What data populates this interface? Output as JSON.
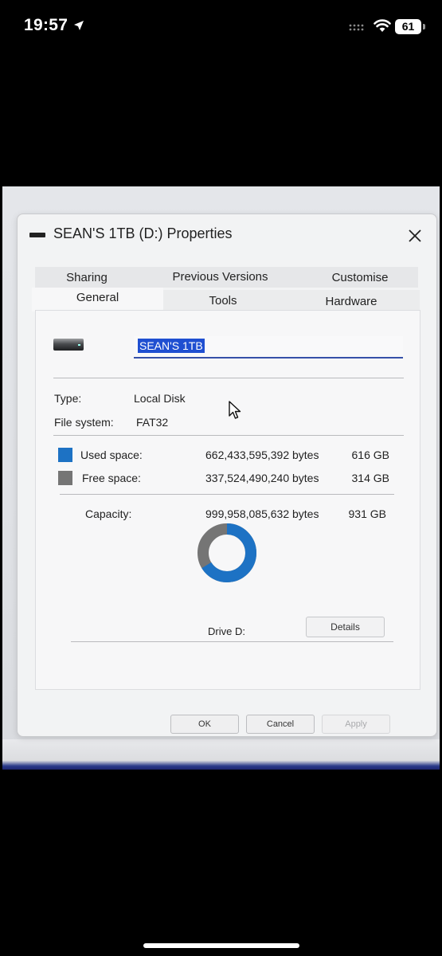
{
  "status_bar": {
    "time": "19:57",
    "battery": "61",
    "icons": [
      "location-arrow-icon",
      "signal-icon",
      "wifi-icon",
      "battery-icon"
    ]
  },
  "dialog": {
    "title": "SEAN'S 1TB (D:) Properties",
    "tabs_back": [
      "Sharing",
      "Previous Versions",
      "Customise"
    ],
    "tabs_front": [
      "General",
      "Tools",
      "Hardware"
    ],
    "active_tab": "General",
    "drive_name_value": "SEAN'S 1TB",
    "type": {
      "label": "Type:",
      "value": "Local Disk"
    },
    "file_system": {
      "label": "File system:",
      "value": "FAT32"
    },
    "used": {
      "label": "Used space:",
      "bytes": "662,433,595,392 bytes",
      "size": "616 GB",
      "color": "#1d72c4"
    },
    "free": {
      "label": "Free space:",
      "bytes": "337,524,490,240 bytes",
      "size": "314 GB",
      "color": "#757575"
    },
    "capacity": {
      "label": "Capacity:",
      "bytes": "999,958,085,632 bytes",
      "size": "931 GB"
    },
    "used_fraction": 0.6625,
    "drive_label": "Drive D:",
    "buttons": {
      "details": "Details",
      "ok": "OK",
      "cancel": "Cancel",
      "apply": "Apply"
    }
  }
}
